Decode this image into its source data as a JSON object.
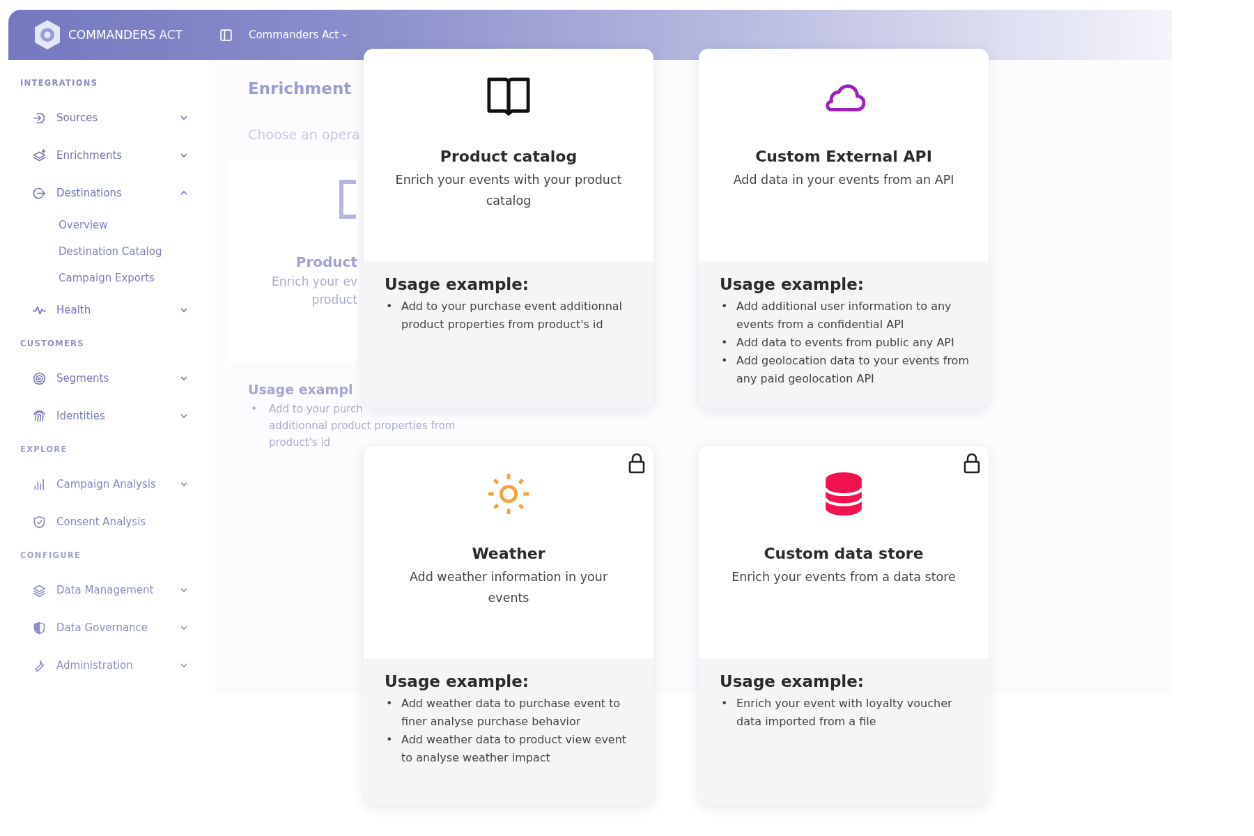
{
  "topbar": {
    "logo_main": "COMMANDERS",
    "logo_accent": "ACT",
    "workspace": "Commanders Act"
  },
  "sidebar": {
    "sections": [
      {
        "title": "INTEGRATIONS",
        "items": [
          {
            "label": "Sources",
            "kind": "menu",
            "expanded": false
          },
          {
            "label": "Enrichments",
            "kind": "menu",
            "expanded": false
          },
          {
            "label": "Destinations",
            "kind": "menu",
            "expanded": true,
            "children": [
              {
                "label": "Overview"
              },
              {
                "label": "Destination Catalog"
              },
              {
                "label": "Campaign Exports"
              }
            ]
          },
          {
            "label": "Health",
            "kind": "menu",
            "expanded": false
          }
        ]
      },
      {
        "title": "CUSTOMERS",
        "items": [
          {
            "label": "Segments",
            "kind": "menu",
            "expanded": false
          },
          {
            "label": "Identities",
            "kind": "menu",
            "expanded": false
          }
        ]
      },
      {
        "title": "EXPLORE",
        "items": [
          {
            "label": "Campaign Analysis",
            "kind": "menu",
            "expanded": false
          },
          {
            "label": "Consent Analysis",
            "kind": "link"
          }
        ]
      },
      {
        "title": "CONFIGURE",
        "items": [
          {
            "label": "Data Management",
            "kind": "menu",
            "expanded": false
          },
          {
            "label": "Data Governance",
            "kind": "menu",
            "expanded": false
          },
          {
            "label": "Administration",
            "kind": "menu",
            "expanded": false
          }
        ]
      }
    ]
  },
  "page": {
    "title": "Enrichment",
    "subtitle": "Choose an opera",
    "ghost_card": {
      "title": "Product",
      "description": [
        "Enrich your ev",
        "product"
      ],
      "usage_title": "Usage exampl",
      "bullet": "•",
      "example_lines": [
        "Add to your purch",
        "additionnal product properties from",
        "product's id"
      ]
    }
  },
  "cards": [
    {
      "kind": "book",
      "title": "Product catalog",
      "description": "Enrich your events with your product catalog",
      "usage_title": "Usage example:",
      "examples": [
        {
          "bullet": "•",
          "text": "Add to your purchase event additionnal product properties from product's id"
        }
      ],
      "locked": false
    },
    {
      "kind": "cloud",
      "title": "Custom External API",
      "description": "Add data in your events from an API",
      "usage_title": "Usage example:",
      "examples": [
        {
          "bullet": "•",
          "text": "Add additional user information to any events from a confidential API"
        },
        {
          "bullet": "•",
          "text": "Add data to events from public any API"
        },
        {
          "bullet": "•",
          "text": "Add geolocation data to your events from any paid geolocation API"
        }
      ],
      "locked": false
    },
    {
      "kind": "sun",
      "title": "Weather",
      "description": "Add weather information in your events",
      "usage_title": "Usage example:",
      "examples": [
        {
          "bullet": "•",
          "text": "Add weather data to purchase event to finer analyse purchase behavior"
        },
        {
          "bullet": "•",
          "text": "Add weather data to product view event to analyse weather impact"
        }
      ],
      "locked": true
    },
    {
      "kind": "database",
      "title": "Custom data store",
      "description": "Enrich your events from a data store",
      "usage_title": "Usage example:",
      "examples": [
        {
          "bullet": "•",
          "text": "Enrich your event with loyalty voucher data imported from a file"
        }
      ],
      "locked": true
    }
  ]
}
